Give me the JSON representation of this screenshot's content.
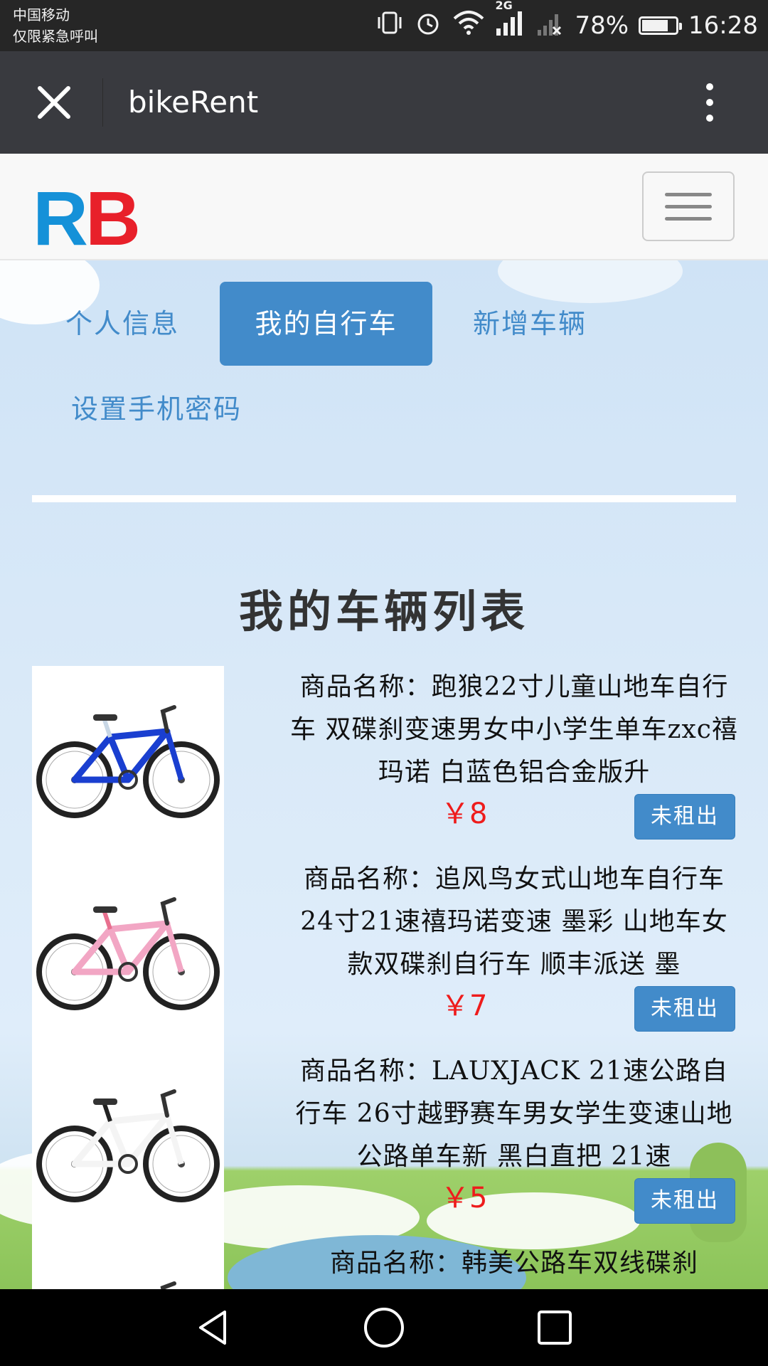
{
  "status_bar": {
    "carrier_line1": "中国移动",
    "carrier_line2": "仅限紧急呼叫",
    "network": "2G",
    "battery_percent": "78%",
    "battery_level": 0.78,
    "time": "16:28"
  },
  "titlebar": {
    "title": "bikeRent"
  },
  "navbar": {
    "logo_r": "R",
    "logo_b": "B"
  },
  "tabs": [
    {
      "label": "个人信息",
      "active": false
    },
    {
      "label": "我的自行车",
      "active": true
    },
    {
      "label": "新增车辆",
      "active": false
    },
    {
      "label": "设置手机密码",
      "active": false
    }
  ],
  "list_title": "我的车辆列表",
  "items": [
    {
      "name": "商品名称：跑狼22寸儿童山地车自行车 双碟刹变速男女中小学生单车zxc禧玛诺 白蓝色铝合金版升",
      "price": "￥8",
      "status": "未租出",
      "frame_color": "#1a3fd0",
      "accent_color": "#c8d7e6"
    },
    {
      "name": "商品名称：追风鸟女式山地车自行车24寸21速禧玛诺变速 墨彩 山地车女款双碟刹自行车 顺丰派送 墨",
      "price": "￥7",
      "status": "未租出",
      "frame_color": "#f2a6c4",
      "accent_color": "#e8708f"
    },
    {
      "name": "商品名称：LAUXJACK 21速公路自行车 26寸越野赛车男女学生变速山地公路单车新 黑白直把 21速",
      "price": "￥5",
      "status": "未租出",
      "frame_color": "#f4f4f4",
      "accent_color": "#222222"
    },
    {
      "name": "商品名称：韩美公路车双线碟刹",
      "price": "",
      "status": "",
      "frame_color": "#222222",
      "accent_color": "#222222"
    }
  ]
}
